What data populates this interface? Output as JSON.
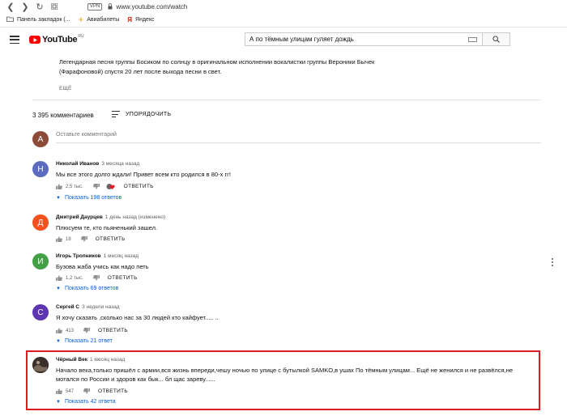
{
  "browser": {
    "url": "www.youtube.com/watch",
    "vpn": "VPN",
    "bookmarks": [
      {
        "label": "Панель закладок (...",
        "icon": "folder-icon"
      },
      {
        "label": "Авиабилеты",
        "icon": "plane-icon"
      },
      {
        "label": "Яндекс",
        "icon": "yandex-icon"
      }
    ]
  },
  "header": {
    "logo": "YouTube",
    "region": "RU",
    "search_value": "А по тёмным улицам гуляет дождь"
  },
  "description": {
    "text": "Легендарная песня группы Босиком по солнцу в оригинальном исполнении вокалистки группы Вероники Бычек (Фарафоновой) спустя 20 лет после выхода песни в свет.",
    "more_label": "ЕЩЁ"
  },
  "comments_header": {
    "count": "3 395 комментариев",
    "sort_label": "УПОРЯДОЧИТЬ"
  },
  "add_comment": {
    "avatar_letter": "А",
    "placeholder": "Оставьте комментарий"
  },
  "comments": [
    {
      "author": "Николай Иванов",
      "time": "3 месяца назад",
      "text": "Мы все этого долго ждали! Привет всем кто родился в 80-х гг!",
      "likes": "2,5 тыс.",
      "reply": "ОТВЕТИТЬ",
      "replies": "Показать 198 ответов",
      "avatar_letter": "Н",
      "avatar_color": "#5c6bc0"
    },
    {
      "author": "Дмитрий Даурцев",
      "time": "1 день назад (изменено)",
      "text": "Плюсуем те, кто пьяненький зашел.",
      "likes": "18",
      "reply": "ОТВЕТИТЬ",
      "avatar_letter": "Д",
      "avatar_color": "#f4511e"
    },
    {
      "author": "Игорь Тропников",
      "time": "1 месяц назад",
      "text": "Бузова жаба учись как надо петь",
      "likes": "1,2 тыс.",
      "reply": "ОТВЕТИТЬ",
      "replies": "Показать 69 ответов",
      "avatar_letter": "И",
      "avatar_color": "#43a047"
    },
    {
      "author": "Сергей С",
      "time": "3 недели назад",
      "text": "Я хочу сказать ,сколько нас за 30 людей кто кайфует..... ..",
      "likes": "413",
      "reply": "ОТВЕТИТЬ",
      "replies": "Показать 21 ответ",
      "avatar_letter": "С",
      "avatar_color": "#5e35b1"
    },
    {
      "author": "Чёрный Век",
      "time": "1 месяц назад",
      "text": "Начало века,только пришёл с армии,вся жизнь впереди,чешу ночью по улице с бутылкой SAMKO,в ушах По тёмным улицам... Ещё не женился и не развёлся,не мотался по России и здоров как бык... бл щас зареву......",
      "likes": "547",
      "reply": "ОТВЕТИТЬ",
      "replies": "Показать 42 ответа",
      "avatar_color": "#3a2f2a"
    }
  ],
  "colors": {
    "link": "#065fd4",
    "highlight": "#e21b23",
    "brand": "#ff0000"
  }
}
